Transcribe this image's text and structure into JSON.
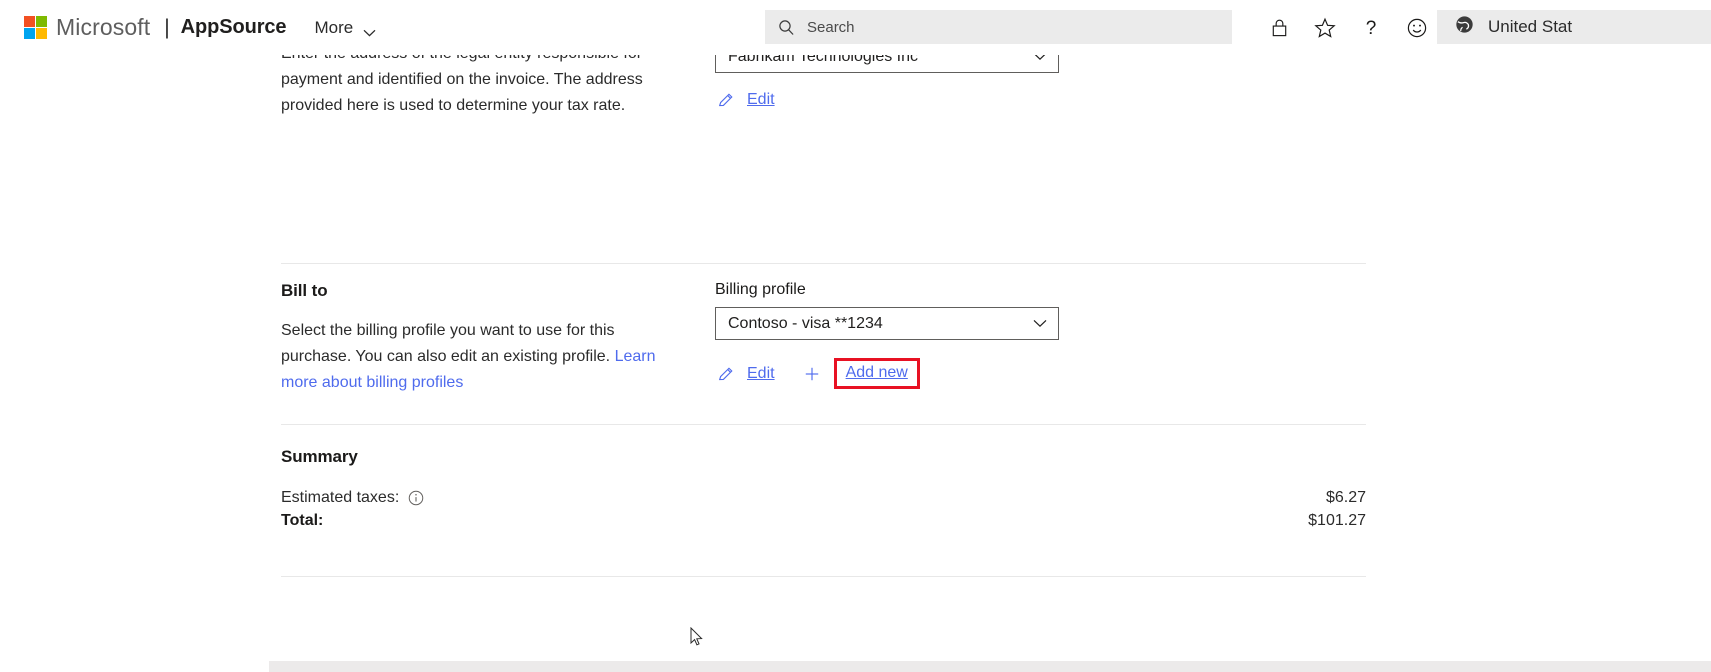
{
  "header": {
    "brand": "Microsoft",
    "divider": "|",
    "product": "AppSource",
    "more_label": "More",
    "search_placeholder": "Search",
    "icons": [
      {
        "name": "lock-icon",
        "title": "Privacy"
      },
      {
        "name": "star-icon",
        "title": "Favorites"
      },
      {
        "name": "help-icon",
        "title": "Help"
      },
      {
        "name": "feedback-icon",
        "title": "Feedback"
      }
    ],
    "region": "United Stat",
    "region_icon": "globe-icon"
  },
  "sections": {
    "sold_to": {
      "desc_line1": "Enter the address of the legal entity responsible for",
      "desc_line2": "payment and identified on the invoice. The address",
      "desc_line3": "provided here is used to determine your tax rate.",
      "select_value": "Fabrikam Technologies Inc",
      "edit_label": "Edit"
    },
    "bill_to": {
      "title": "Bill to",
      "desc_part1": "Select the billing profile you want to use for this purchase. You can also edit an existing profile. ",
      "desc_link": "Learn more about billing profiles",
      "field_label": "Billing profile",
      "select_value": "Contoso - visa **1234",
      "edit_label": "Edit",
      "add_new_label": "Add new"
    },
    "summary": {
      "title": "Summary",
      "rows": [
        {
          "label": "Estimated taxes:",
          "value": "$6.27",
          "bold": false,
          "has_info": true
        },
        {
          "label": "Total:",
          "value": "$101.27",
          "bold": true,
          "has_info": false
        }
      ]
    }
  },
  "colors": {
    "link": "#4f6bed",
    "highlight": "#e81123",
    "header_bg": "#ffffff",
    "search_bg": "#ebebeb",
    "divider": "#e8e8e8"
  }
}
